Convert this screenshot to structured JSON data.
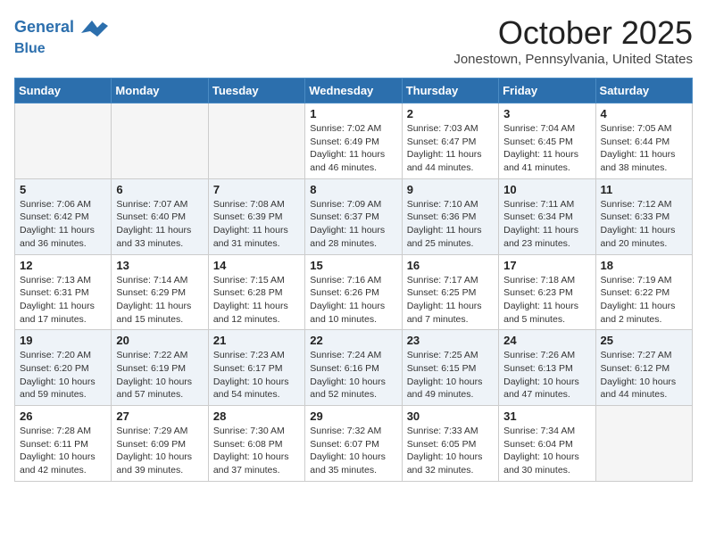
{
  "header": {
    "logo_line1": "General",
    "logo_line2": "Blue",
    "month": "October 2025",
    "location": "Jonestown, Pennsylvania, United States"
  },
  "weekdays": [
    "Sunday",
    "Monday",
    "Tuesday",
    "Wednesday",
    "Thursday",
    "Friday",
    "Saturday"
  ],
  "weeks": [
    [
      {
        "day": "",
        "info": ""
      },
      {
        "day": "",
        "info": ""
      },
      {
        "day": "",
        "info": ""
      },
      {
        "day": "1",
        "info": "Sunrise: 7:02 AM\nSunset: 6:49 PM\nDaylight: 11 hours and 46 minutes."
      },
      {
        "day": "2",
        "info": "Sunrise: 7:03 AM\nSunset: 6:47 PM\nDaylight: 11 hours and 44 minutes."
      },
      {
        "day": "3",
        "info": "Sunrise: 7:04 AM\nSunset: 6:45 PM\nDaylight: 11 hours and 41 minutes."
      },
      {
        "day": "4",
        "info": "Sunrise: 7:05 AM\nSunset: 6:44 PM\nDaylight: 11 hours and 38 minutes."
      }
    ],
    [
      {
        "day": "5",
        "info": "Sunrise: 7:06 AM\nSunset: 6:42 PM\nDaylight: 11 hours and 36 minutes."
      },
      {
        "day": "6",
        "info": "Sunrise: 7:07 AM\nSunset: 6:40 PM\nDaylight: 11 hours and 33 minutes."
      },
      {
        "day": "7",
        "info": "Sunrise: 7:08 AM\nSunset: 6:39 PM\nDaylight: 11 hours and 31 minutes."
      },
      {
        "day": "8",
        "info": "Sunrise: 7:09 AM\nSunset: 6:37 PM\nDaylight: 11 hours and 28 minutes."
      },
      {
        "day": "9",
        "info": "Sunrise: 7:10 AM\nSunset: 6:36 PM\nDaylight: 11 hours and 25 minutes."
      },
      {
        "day": "10",
        "info": "Sunrise: 7:11 AM\nSunset: 6:34 PM\nDaylight: 11 hours and 23 minutes."
      },
      {
        "day": "11",
        "info": "Sunrise: 7:12 AM\nSunset: 6:33 PM\nDaylight: 11 hours and 20 minutes."
      }
    ],
    [
      {
        "day": "12",
        "info": "Sunrise: 7:13 AM\nSunset: 6:31 PM\nDaylight: 11 hours and 17 minutes."
      },
      {
        "day": "13",
        "info": "Sunrise: 7:14 AM\nSunset: 6:29 PM\nDaylight: 11 hours and 15 minutes."
      },
      {
        "day": "14",
        "info": "Sunrise: 7:15 AM\nSunset: 6:28 PM\nDaylight: 11 hours and 12 minutes."
      },
      {
        "day": "15",
        "info": "Sunrise: 7:16 AM\nSunset: 6:26 PM\nDaylight: 11 hours and 10 minutes."
      },
      {
        "day": "16",
        "info": "Sunrise: 7:17 AM\nSunset: 6:25 PM\nDaylight: 11 hours and 7 minutes."
      },
      {
        "day": "17",
        "info": "Sunrise: 7:18 AM\nSunset: 6:23 PM\nDaylight: 11 hours and 5 minutes."
      },
      {
        "day": "18",
        "info": "Sunrise: 7:19 AM\nSunset: 6:22 PM\nDaylight: 11 hours and 2 minutes."
      }
    ],
    [
      {
        "day": "19",
        "info": "Sunrise: 7:20 AM\nSunset: 6:20 PM\nDaylight: 10 hours and 59 minutes."
      },
      {
        "day": "20",
        "info": "Sunrise: 7:22 AM\nSunset: 6:19 PM\nDaylight: 10 hours and 57 minutes."
      },
      {
        "day": "21",
        "info": "Sunrise: 7:23 AM\nSunset: 6:17 PM\nDaylight: 10 hours and 54 minutes."
      },
      {
        "day": "22",
        "info": "Sunrise: 7:24 AM\nSunset: 6:16 PM\nDaylight: 10 hours and 52 minutes."
      },
      {
        "day": "23",
        "info": "Sunrise: 7:25 AM\nSunset: 6:15 PM\nDaylight: 10 hours and 49 minutes."
      },
      {
        "day": "24",
        "info": "Sunrise: 7:26 AM\nSunset: 6:13 PM\nDaylight: 10 hours and 47 minutes."
      },
      {
        "day": "25",
        "info": "Sunrise: 7:27 AM\nSunset: 6:12 PM\nDaylight: 10 hours and 44 minutes."
      }
    ],
    [
      {
        "day": "26",
        "info": "Sunrise: 7:28 AM\nSunset: 6:11 PM\nDaylight: 10 hours and 42 minutes."
      },
      {
        "day": "27",
        "info": "Sunrise: 7:29 AM\nSunset: 6:09 PM\nDaylight: 10 hours and 39 minutes."
      },
      {
        "day": "28",
        "info": "Sunrise: 7:30 AM\nSunset: 6:08 PM\nDaylight: 10 hours and 37 minutes."
      },
      {
        "day": "29",
        "info": "Sunrise: 7:32 AM\nSunset: 6:07 PM\nDaylight: 10 hours and 35 minutes."
      },
      {
        "day": "30",
        "info": "Sunrise: 7:33 AM\nSunset: 6:05 PM\nDaylight: 10 hours and 32 minutes."
      },
      {
        "day": "31",
        "info": "Sunrise: 7:34 AM\nSunset: 6:04 PM\nDaylight: 10 hours and 30 minutes."
      },
      {
        "day": "",
        "info": ""
      }
    ]
  ]
}
